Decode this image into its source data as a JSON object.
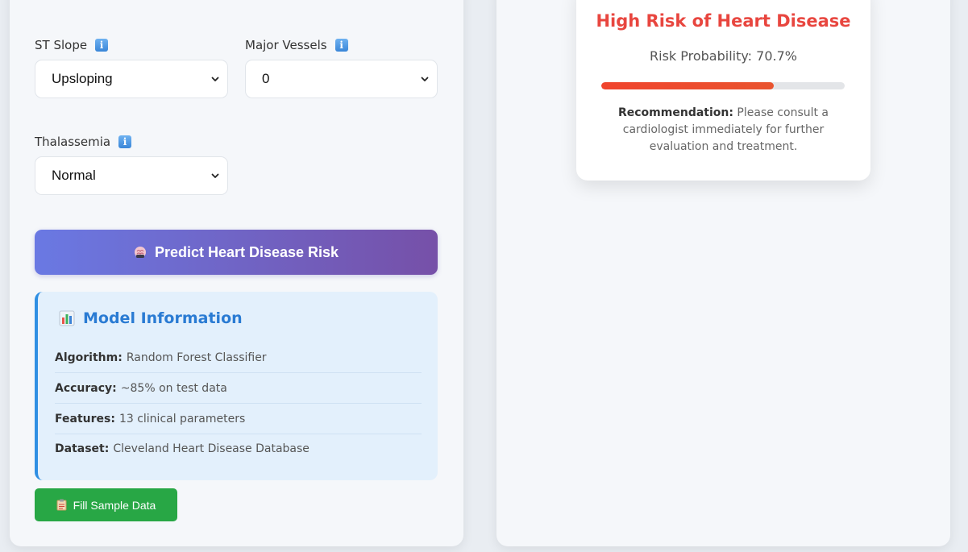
{
  "form": {
    "st_slope": {
      "label": "ST Slope",
      "value": "Upsloping"
    },
    "major_vessels": {
      "label": "Major Vessels",
      "value": "0"
    },
    "thalassemia": {
      "label": "Thalassemia",
      "value": "Normal"
    },
    "predict_button": "Predict Heart Disease Risk",
    "fill_sample_button": "Fill Sample Data"
  },
  "model_info": {
    "title": "Model Information",
    "rows": [
      {
        "key": "Algorithm:",
        "value": "Random Forest Classifier"
      },
      {
        "key": "Accuracy:",
        "value": "~85% on test data"
      },
      {
        "key": "Features:",
        "value": "13 clinical parameters"
      },
      {
        "key": "Dataset:",
        "value": "Cleveland Heart Disease Database"
      }
    ]
  },
  "result": {
    "title": "High Risk of Heart Disease",
    "probability_text": "Risk Probability: 70.7%",
    "probability_fraction": 0.707,
    "recommendation_label": "Recommendation:",
    "recommendation_text": "Please consult a cardiologist immediately for further evaluation and treatment."
  },
  "colors": {
    "accent": "#2a7bd3",
    "danger": "#e8463f",
    "success": "#28a745",
    "gradient_start": "#6a79e3",
    "gradient_end": "#7650a8"
  },
  "icons": {
    "info": "info-icon",
    "chevron": "chevron-down-icon",
    "predict": "brain-icon",
    "model": "bar-chart-icon",
    "fill": "clipboard-icon"
  }
}
